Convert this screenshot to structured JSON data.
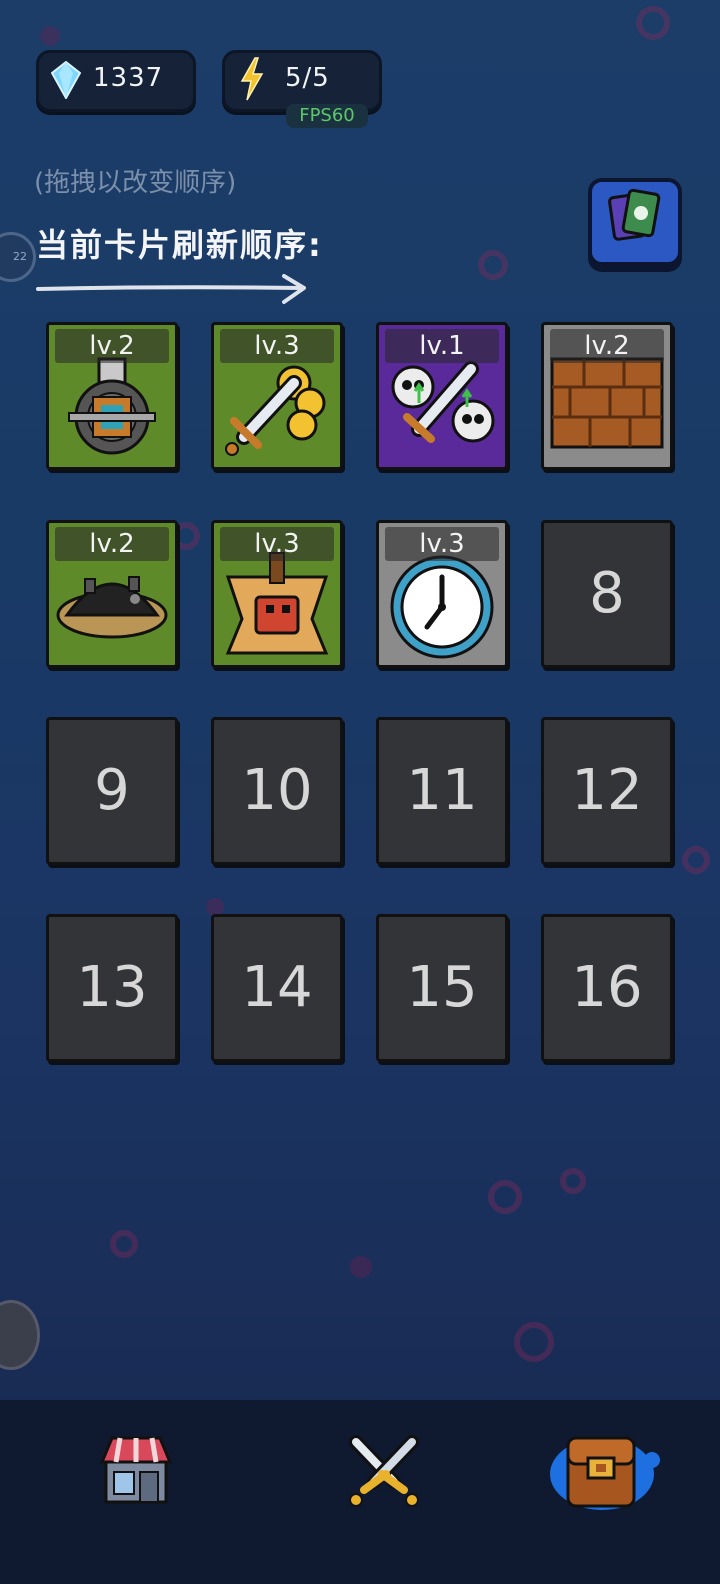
{
  "currency": {
    "gems": "1337",
    "energy": "5/5",
    "fps": "FPS60"
  },
  "hint": "(拖拽以改变顺序)",
  "title": "当前卡片刷新顺序:",
  "side_badge": "22",
  "cards": [
    {
      "type": "filled",
      "color": "green",
      "level": "lv.2",
      "icon": "turret-icon"
    },
    {
      "type": "filled",
      "color": "green",
      "level": "lv.3",
      "icon": "sword-coins-icon"
    },
    {
      "type": "filled",
      "color": "purple",
      "level": "lv.1",
      "icon": "skull-sword-icon"
    },
    {
      "type": "filled",
      "color": "gray",
      "level": "lv.2",
      "icon": "brick-wall-icon"
    },
    {
      "type": "filled",
      "color": "green",
      "level": "lv.2",
      "icon": "mine-icon"
    },
    {
      "type": "filled",
      "color": "green",
      "level": "lv.3",
      "icon": "robot-pad-icon"
    },
    {
      "type": "filled",
      "color": "gray",
      "level": "lv.3",
      "icon": "clock-icon"
    },
    {
      "type": "empty",
      "label": "8"
    },
    {
      "type": "empty",
      "label": "9"
    },
    {
      "type": "empty",
      "label": "10"
    },
    {
      "type": "empty",
      "label": "11"
    },
    {
      "type": "empty",
      "label": "12"
    },
    {
      "type": "empty",
      "label": "13"
    },
    {
      "type": "empty",
      "label": "14"
    },
    {
      "type": "empty",
      "label": "15"
    },
    {
      "type": "empty",
      "label": "16"
    }
  ],
  "nav": {
    "shop": "shop-icon",
    "battle": "crossed-swords-icon",
    "bag": "backpack-icon"
  },
  "colors": {
    "bg": "#1b3d68",
    "card_green": "#5f8a2a",
    "card_purple": "#5a2a9a",
    "card_gray": "#8b8b8b",
    "card_empty": "#333437",
    "gem": "#7fd7ff",
    "energy": "#f2c230"
  }
}
